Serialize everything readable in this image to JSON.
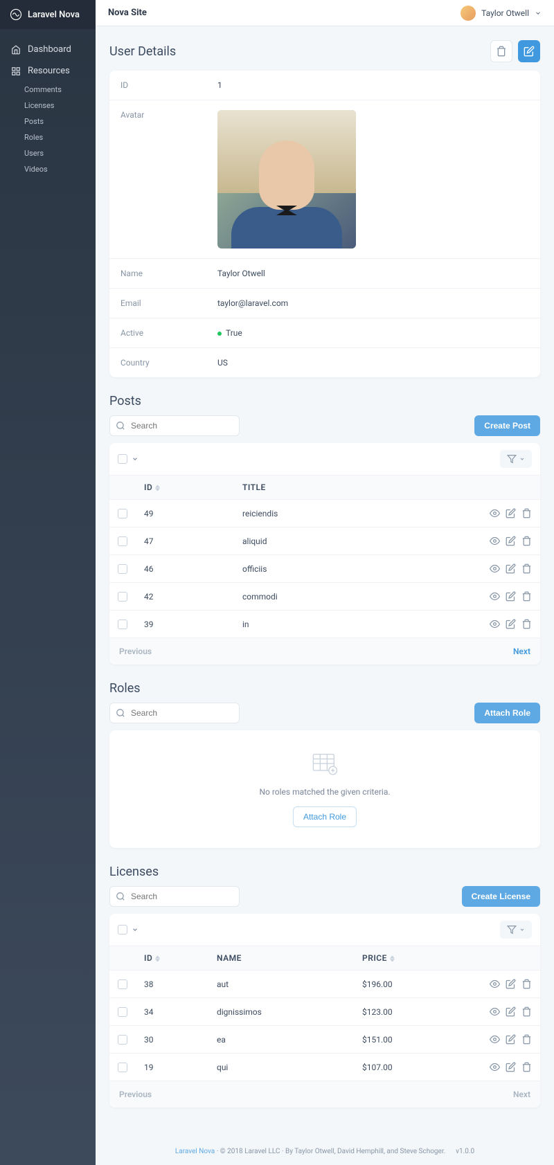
{
  "brand": "Laravel Nova",
  "header": {
    "site_title": "Nova Site",
    "user_name": "Taylor Otwell"
  },
  "nav": {
    "dashboard": "Dashboard",
    "resources": "Resources",
    "items": [
      "Comments",
      "Licenses",
      "Posts",
      "Roles",
      "Users",
      "Videos"
    ]
  },
  "user_details": {
    "title": "User Details",
    "fields": {
      "id_label": "ID",
      "id_value": "1",
      "avatar_label": "Avatar",
      "name_label": "Name",
      "name_value": "Taylor Otwell",
      "email_label": "Email",
      "email_value": "taylor@laravel.com",
      "active_label": "Active",
      "active_value": "True",
      "country_label": "Country",
      "country_value": "US"
    }
  },
  "posts": {
    "title": "Posts",
    "search_placeholder": "Search",
    "create_button": "Create Post",
    "columns": {
      "id": "ID",
      "title": "TITLE"
    },
    "rows": [
      {
        "id": "49",
        "title": "reiciendis"
      },
      {
        "id": "47",
        "title": "aliquid"
      },
      {
        "id": "46",
        "title": "officiis"
      },
      {
        "id": "42",
        "title": "commodi"
      },
      {
        "id": "39",
        "title": "in"
      }
    ],
    "prev": "Previous",
    "next": "Next"
  },
  "roles": {
    "title": "Roles",
    "search_placeholder": "Search",
    "attach_button": "Attach Role",
    "empty_text": "No roles matched the given criteria.",
    "empty_action": "Attach Role"
  },
  "licenses": {
    "title": "Licenses",
    "search_placeholder": "Search",
    "create_button": "Create License",
    "columns": {
      "id": "ID",
      "name": "NAME",
      "price": "PRICE"
    },
    "rows": [
      {
        "id": "38",
        "name": "aut",
        "price": "$196.00"
      },
      {
        "id": "34",
        "name": "dignissimos",
        "price": "$123.00"
      },
      {
        "id": "30",
        "name": "ea",
        "price": "$151.00"
      },
      {
        "id": "19",
        "name": "qui",
        "price": "$107.00"
      }
    ],
    "prev": "Previous",
    "next": "Next"
  },
  "footer": {
    "link": "Laravel Nova",
    "text": " · © 2018 Laravel LLC · By Taylor Otwell, David Hemphill, and Steve Schoger.",
    "version": "v1.0.0"
  }
}
